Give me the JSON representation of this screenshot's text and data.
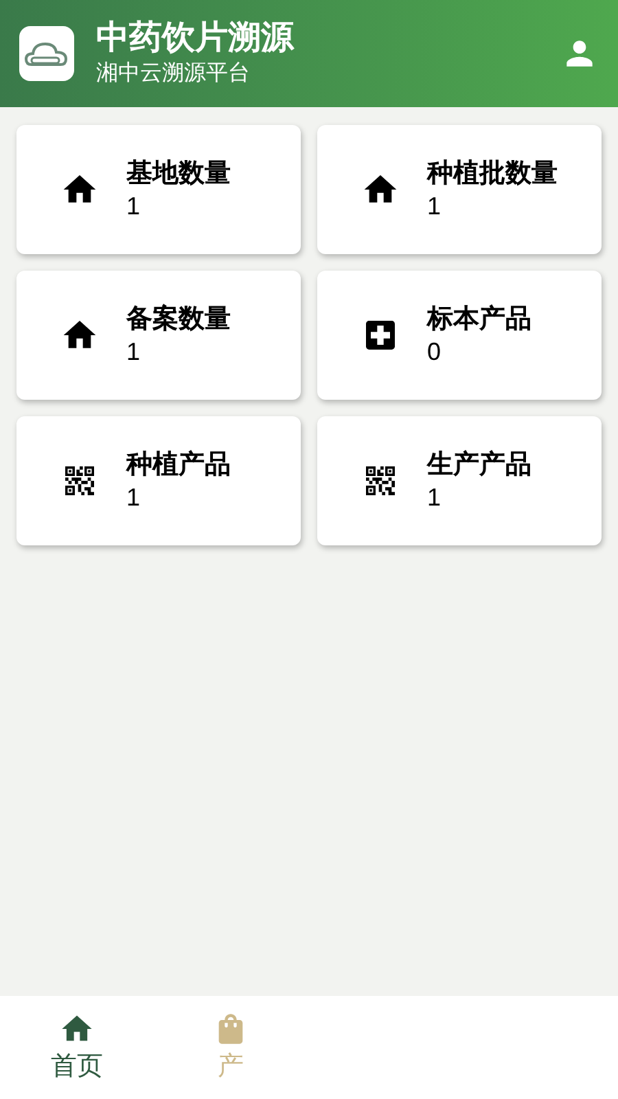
{
  "header": {
    "title": "中药饮片溯源",
    "subtitle": "湘中云溯源平台"
  },
  "cards": [
    {
      "kind": "home",
      "label": "基地数量",
      "count": "1"
    },
    {
      "kind": "home",
      "label": "种植批数量",
      "count": "1"
    },
    {
      "kind": "home",
      "label": "备案数量",
      "count": "1"
    },
    {
      "kind": "plus",
      "label": "标本产品",
      "count": "0"
    },
    {
      "kind": "qr",
      "label": "种植产品",
      "count": "1"
    },
    {
      "kind": "qr",
      "label": "生产产品",
      "count": "1"
    }
  ],
  "nav": [
    {
      "kind": "home",
      "label": "首页",
      "selected": true
    },
    {
      "kind": "bag",
      "label": "产",
      "selected": false
    }
  ]
}
